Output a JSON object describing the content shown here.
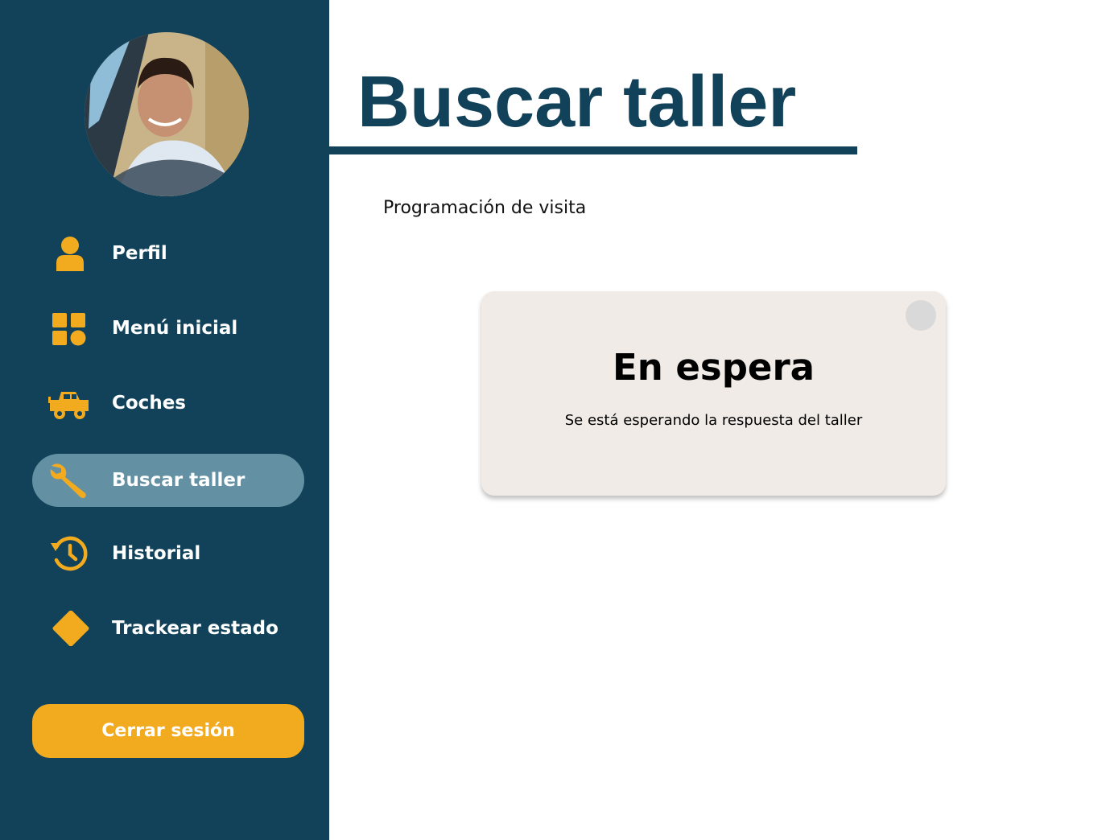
{
  "colors": {
    "sidebar_bg": "#114259",
    "accent": "#f2ab1e",
    "active_item_bg": "#6391a3",
    "card_bg": "#f0ebe6",
    "title": "#114259"
  },
  "sidebar": {
    "avatar": {
      "icon": "driver-photo"
    },
    "items": [
      {
        "label": "Perfil",
        "icon": "person-icon",
        "active": false
      },
      {
        "label": "Menú inicial",
        "icon": "grid-icon",
        "active": false
      },
      {
        "label": "Coches",
        "icon": "jeep-icon",
        "active": false
      },
      {
        "label": "Buscar taller",
        "icon": "wrench-icon",
        "active": true
      },
      {
        "label": "Historial",
        "icon": "history-icon",
        "active": false
      },
      {
        "label": "Trackear estado",
        "icon": "diamond-icon",
        "active": false
      }
    ],
    "logout_label": "Cerrar sesión"
  },
  "main": {
    "title": "Buscar taller",
    "section_label": "Programación de visita",
    "status_card": {
      "title": "En espera",
      "message": "Se está esperando la respuesta del taller"
    }
  }
}
